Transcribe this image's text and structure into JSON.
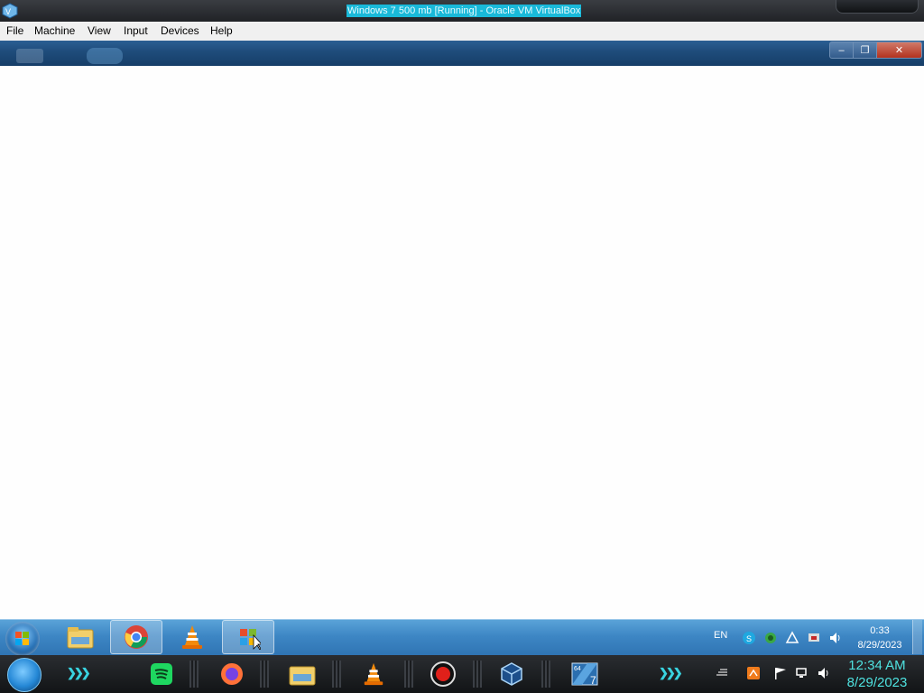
{
  "host": {
    "window_title": "Windows 7 500 mb [Running] - Oracle VM VirtualBox",
    "menu": [
      "File",
      "Machine",
      "View",
      "Input",
      "Devices",
      "Help"
    ]
  },
  "guest": {
    "window_controls": {
      "minimize": "–",
      "maximize": "❐",
      "close": "✕"
    },
    "taskbar": {
      "pinned": [
        "explorer-icon",
        "chrome-icon",
        "vlc-icon",
        "windows-setup-icon"
      ],
      "language": "EN",
      "clock_time": "0:33",
      "clock_date": "8/29/2023"
    }
  },
  "host_taskbar": {
    "apps": [
      "spotify-icon",
      "firefox-icon",
      "file-explorer-icon",
      "vlc-icon",
      "record-icon",
      "virtualbox-icon",
      "windows7-64-icon"
    ],
    "clock_time": "12:34 AM",
    "clock_date": "8/29/2023"
  }
}
